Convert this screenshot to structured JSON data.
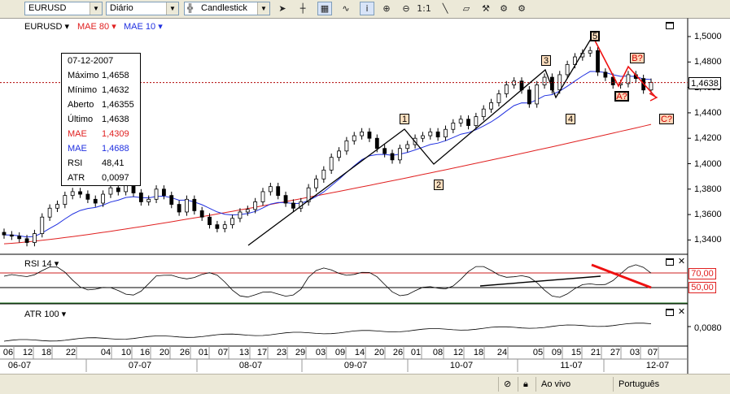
{
  "toolbar": {
    "symbol": "EURUSD",
    "period": "Diário",
    "chart_type": "Candlestick",
    "icons": [
      "cursor-icon",
      "crosshair-icon",
      "grid-icon",
      "indicators-icon",
      "info-icon",
      "zoom-in-icon",
      "zoom-out-icon",
      "zoom-reset-label",
      "trendline-icon",
      "eraser-icon",
      "paint-icon",
      "properties-icon"
    ],
    "zoom_reset_label": "1:1"
  },
  "legend": {
    "symbol": "EURUSD",
    "mae80": "MAE 80",
    "mae10": "MAE 10",
    "colors": {
      "mae80": "#e02020",
      "mae10": "#2030e0"
    }
  },
  "infobox": {
    "date": "07-12-2007",
    "rows": [
      {
        "k": "Máximo",
        "v": "1,4658",
        "color": "#000000"
      },
      {
        "k": "Mínimo",
        "v": "1,4632",
        "color": "#000000"
      },
      {
        "k": "Aberto",
        "v": "1,46355",
        "color": "#000000"
      },
      {
        "k": "Último",
        "v": "1,4638",
        "color": "#000000"
      },
      {
        "k": "MAE",
        "v": "1,4309",
        "color": "#e02020"
      },
      {
        "k": "MAE",
        "v": "1,4688",
        "color": "#2030e0"
      },
      {
        "k": "RSI",
        "v": "48,41",
        "color": "#000000"
      },
      {
        "k": "ATR",
        "v": "0,0097",
        "color": "#000000"
      }
    ]
  },
  "price_axis": {
    "labels": [
      "1,5000",
      "1,4800",
      "1,4600",
      "1,4400",
      "1,4200",
      "1,4000",
      "1,3800",
      "1,3600",
      "1,3400"
    ],
    "current": "1,4638"
  },
  "waves": {
    "w1": "1",
    "w2": "2",
    "w3": "3",
    "w4": "4",
    "w5": "5",
    "a": "A?",
    "b": "B?",
    "c": "C?"
  },
  "rsi": {
    "title": "RSI 14",
    "upper": "70,00",
    "lower": "50,00"
  },
  "atr": {
    "title": "ATR 100",
    "value": "0,0080"
  },
  "x_axis": {
    "days": [
      "06",
      "12",
      "18",
      "22",
      "04",
      "10",
      "16",
      "20",
      "26",
      "01",
      "07",
      "13",
      "17",
      "23",
      "29",
      "03",
      "09",
      "14",
      "20",
      "26",
      "01",
      "08",
      "12",
      "18",
      "24",
      "05",
      "09",
      "15",
      "21",
      "27",
      "03",
      "07"
    ],
    "months": [
      "06-07",
      "07-07",
      "08-07",
      "09-07",
      "10-07",
      "11-07",
      "12-07"
    ]
  },
  "status": {
    "live": "Ao vivo",
    "language": "Português"
  },
  "chart_data": {
    "type": "candlestick",
    "symbol": "EURUSD",
    "period": "Diário",
    "ylim": [
      1.325,
      1.51
    ],
    "series_close": [
      1.344,
      1.343,
      1.341,
      1.338,
      1.345,
      1.358,
      1.365,
      1.368,
      1.375,
      1.378,
      1.376,
      1.372,
      1.369,
      1.376,
      1.381,
      1.378,
      1.383,
      1.377,
      1.37,
      1.372,
      1.38,
      1.375,
      1.368,
      1.362,
      1.372,
      1.363,
      1.358,
      1.352,
      1.349,
      1.352,
      1.357,
      1.362,
      1.364,
      1.37,
      1.378,
      1.382,
      1.375,
      1.369,
      1.365,
      1.37,
      1.381,
      1.388,
      1.395,
      1.405,
      1.41,
      1.418,
      1.422,
      1.425,
      1.42,
      1.412,
      1.408,
      1.403,
      1.412,
      1.415,
      1.42,
      1.422,
      1.425,
      1.421,
      1.427,
      1.432,
      1.435,
      1.43,
      1.437,
      1.443,
      1.448,
      1.455,
      1.462,
      1.465,
      1.458,
      1.447,
      1.462,
      1.468,
      1.458,
      1.47,
      1.478,
      1.484,
      1.487,
      1.489,
      1.472,
      1.468,
      1.462,
      1.463,
      1.47,
      1.467,
      1.458,
      1.464
    ],
    "mae80_start": 1.34,
    "mae80_end": 1.4309,
    "rsi_levels": [
      70,
      50
    ],
    "atr_last": 0.0097
  }
}
